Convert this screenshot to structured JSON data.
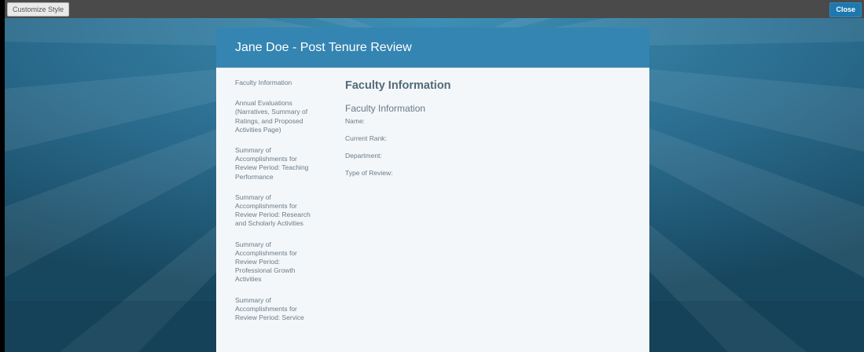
{
  "toolbar": {
    "customize_label": "Customize Style",
    "close_label": "Close"
  },
  "panel": {
    "title": "Jane Doe - Post Tenure Review"
  },
  "nav": {
    "items": [
      {
        "label": "Faculty Information"
      },
      {
        "label": "Annual Evaluations (Narratives, Summary of Ratings, and Proposed Activities Page)"
      },
      {
        "label": "Summary of Accomplishments for Review Period: Teaching Performance"
      },
      {
        "label": "Summary of Accomplishments for Review Period: Research and Scholarly Activities"
      },
      {
        "label": "Summary of Accomplishments for Review Period: Professional Growth Activities"
      },
      {
        "label": "Summary of Accomplishments for Review Period: Service"
      }
    ]
  },
  "main": {
    "section_title": "Faculty Information",
    "subsection_title": "Faculty Information",
    "fields": [
      {
        "label": "Name:"
      },
      {
        "label": "Current Rank:"
      },
      {
        "label": "Department:"
      },
      {
        "label": "Type of Review:"
      }
    ]
  },
  "colors": {
    "background": "#2b6d8f",
    "header": "#3485b1",
    "close_button": "#1d78ad",
    "panel": "#f4f7f9"
  }
}
